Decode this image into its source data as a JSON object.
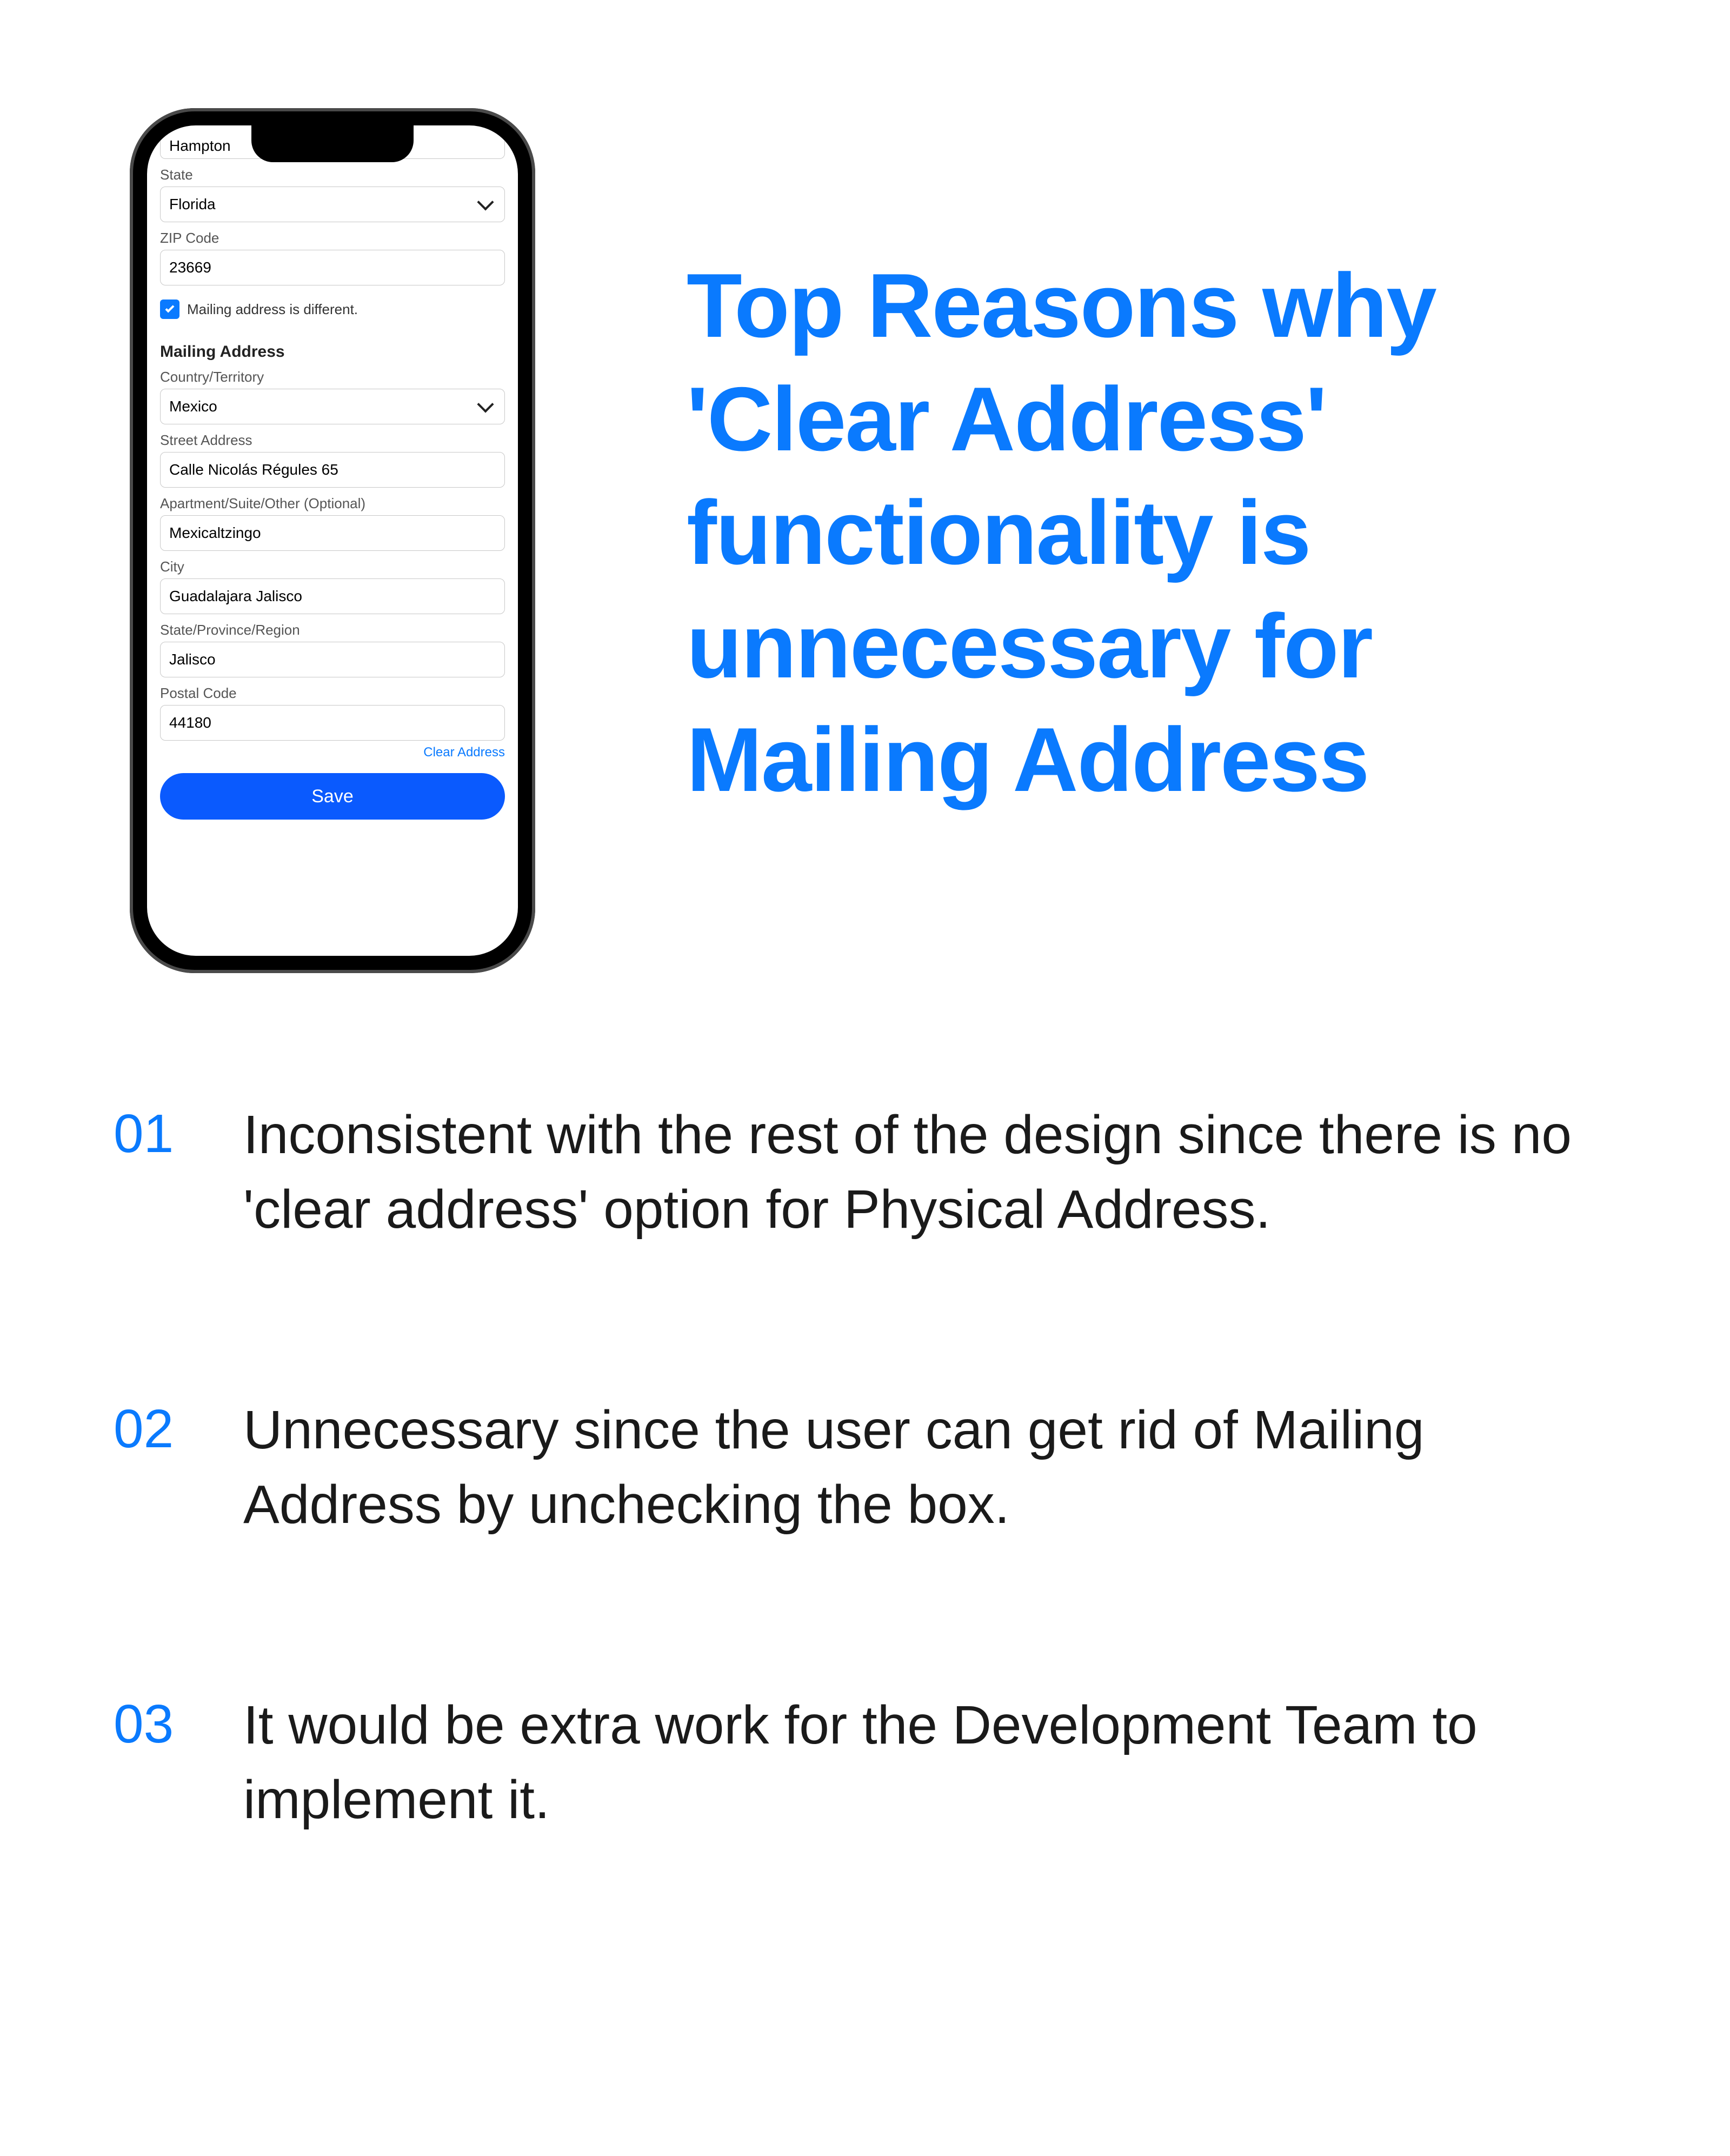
{
  "headline": "Top Reasons why 'Clear Address' functionality is unnecessary for Mailing Address",
  "phone": {
    "top_value": "Hampton",
    "state_label": "State",
    "state_value": "Florida",
    "zip_label": "ZIP Code",
    "zip_value": "23669",
    "mailing_diff_label": "Mailing address is different.",
    "mailing_section_title": "Mailing Address",
    "country_label": "Country/Territory",
    "country_value": "Mexico",
    "street_label": "Street Address",
    "street_value": "Calle Nicolás Régules 65",
    "apt_label": "Apartment/Suite/Other (Optional)",
    "apt_value": "Mexicaltzingo",
    "city_label": "City",
    "city_value": "Guadalajara Jalisco",
    "region_label": "State/Province/Region",
    "region_value": "Jalisco",
    "postal_label": "Postal Code",
    "postal_value": "44180",
    "clear_link": "Clear Address",
    "save_label": "Save"
  },
  "reasons": [
    {
      "num": "01",
      "text": "Inconsistent with the rest of the design since there is no 'clear address' option for Physical Address."
    },
    {
      "num": "02",
      "text": "Unnecessary since the user can get rid of Mailing Address by unchecking the box."
    },
    {
      "num": "03",
      "text": "It would be extra work for the Development Team to implement it."
    }
  ]
}
